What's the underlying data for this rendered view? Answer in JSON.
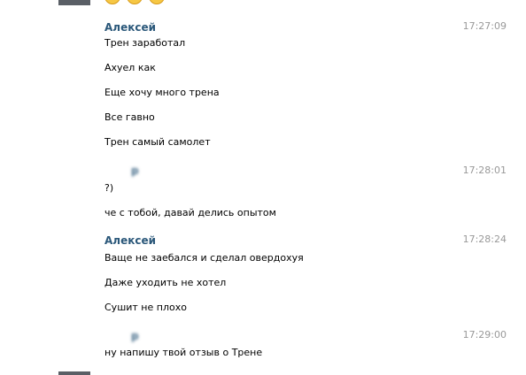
{
  "messages": [
    {
      "author": "Алексей",
      "time": "17:27:09",
      "lines": [
        "Трен заработал",
        "Ахуел как",
        "Еще хочу много трена",
        "Все гавно",
        "Трен самый самолет"
      ]
    },
    {
      "author": "р",
      "time": "17:28:01",
      "lines": [
        "?)",
        "че с тобой, давай делись опытом"
      ]
    },
    {
      "author": "Алексей",
      "time": "17:28:24",
      "lines": [
        "Ваще не заебался и сделал овердохуя",
        "Даже уходить не хотел",
        "Сушит не плохо"
      ]
    },
    {
      "author": "р",
      "time": "17:29:00",
      "lines": [
        "ну напишу твой отзыв о Трене"
      ]
    }
  ],
  "emoji_icons": [
    "smile-emoji-icon",
    "smile-emoji-icon",
    "smile-emoji-icon"
  ]
}
